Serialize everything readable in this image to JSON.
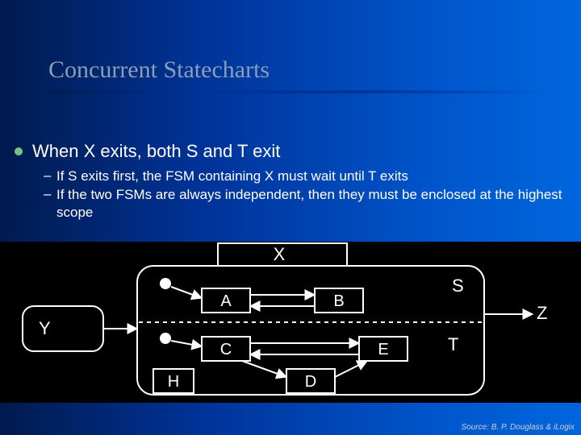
{
  "slide": {
    "title": "Concurrent Statecharts",
    "bullet": "When X exits, both S and T exit",
    "subs": [
      "If S exits first, the FSM containing X must wait until T exits",
      "If the two FSMs are always independent, then they must be enclosed at the highest scope"
    ],
    "credit": "Source: B. P. Douglass & iLogix"
  },
  "diagram": {
    "labels": {
      "X": "X",
      "S": "S",
      "T": "T",
      "A": "A",
      "B": "B",
      "C": "C",
      "D": "D",
      "E": "E",
      "H": "H",
      "Y": "Y",
      "Z": "Z"
    }
  }
}
